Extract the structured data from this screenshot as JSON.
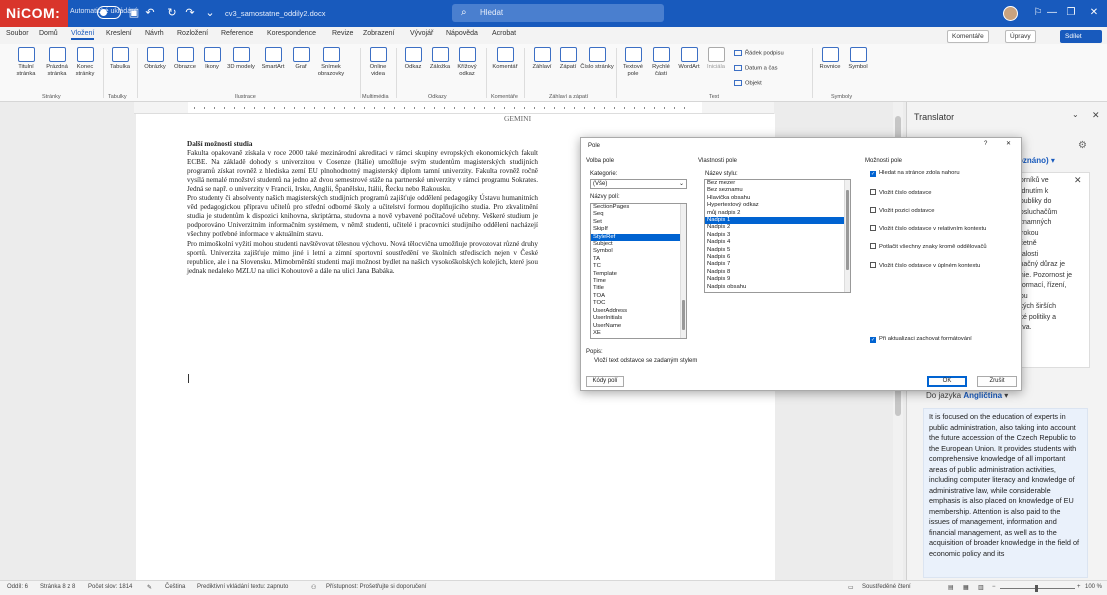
{
  "titlebar": {
    "logo": "NiCOM:",
    "autosave": "Automatické ukládání",
    "docname": "cv3_samostatne_oddily2.docx",
    "search_placeholder": "Hledat",
    "icons": [
      "save-icon",
      "undo-icon",
      "redo-icon",
      "refresh-icon",
      "more-icon"
    ]
  },
  "menubar": {
    "tabs": [
      "Soubor",
      "Domů",
      "Vložení",
      "Kreslení",
      "Návrh",
      "Rozložení",
      "Reference",
      "Korespondence",
      "Revize",
      "Zobrazení",
      "Vývojář",
      "Nápověda",
      "Acrobat"
    ],
    "active": "Vložení",
    "comments": "Komentáře",
    "editing": "Úpravy",
    "share": "Sdílet"
  },
  "ribbon": {
    "items": [
      "Titulní stránka",
      "Prázdná stránka",
      "Konec stránky",
      "Tabulka",
      "Obrázky",
      "Obrazce",
      "Ikony",
      "3D modely",
      "SmartArt",
      "Graf",
      "Snímek obrazovky",
      "Online videa",
      "Odkaz",
      "Záložka",
      "Křížový odkaz",
      "Komentář",
      "Záhlaví",
      "Zápatí",
      "Číslo stránky",
      "Textové pole",
      "Rychlé části",
      "WordArt",
      "Iniciála",
      "Rovnice",
      "Symbol"
    ],
    "small": [
      "Řádek podpisu",
      "Datum a čas",
      "Objekt"
    ],
    "groups": [
      "Stránky",
      "Tabulky",
      "Ilustrace",
      "Multimédia",
      "Odkazy",
      "Komentáře",
      "Záhlaví a zápatí",
      "Text",
      "Symboly"
    ]
  },
  "document": {
    "header": "GEMINI",
    "heading": "Další možnosti studia",
    "paragraphs": [
      "Fakulta opakovaně získala v roce 2000 také mezinárodní akreditaci v rámci skupiny evropských ekonomických fakult ECBE. Na základě dohody s univerzitou v Cosenze (Itálie) umožňuje svým studentům magisterských studijních programů získat rovněž z hlediska zemí EU plnohodnotný magisterský diplom tamní univerzity. Fakulta rovněž ročně vysílá nemalé množství studentů na jedno až dvou semestrové stáže na partnerské univerzity v rámci programu Sokrates. Jedná se např. o univerzity v Francii, Irsku, Anglii, Španělsku, Itálii, Řecku nebo Rakousku.",
      "Pro studenty či absolventy našich magisterských studijních programů zajišťuje oddělení pedagogiky Ústavu humanitních věd pedagogickou přípravu učitelů pro střední odborné školy a učitelství formou doplňujícího studia. Pro zkvalitnění studia je studentům k dispozici knihovna, skriptárna, studovna a nově vybavené počítačové učebny. Veškeré studium je podporováno Univerzitním informačním systémem, v němž studenti, učitelé i pracovníci studijního oddělení nacházejí všechny potřebné informace v aktuálním stavu.",
      "Pro mimoškolní vyžití mohou studenti navštěvovat tělesnou výchovu. Nová tělocvična umožňuje provozovat různé druhy sportů. Univerzita zajišťuje mimo jiné i letní a zimní sportovní soustředění ve školních střediscích nejen v České republice, ale i na Slovensku. Mimobrněnští studenti mají možnost bydlet na našich vysokoškolských kolejích, které jsou jednak nedaleko MZLU na ulici Kohoutově a dále na ulici Jana Babáka."
    ]
  },
  "dialog": {
    "title": "Pole",
    "help": "?",
    "close": "✕",
    "field_choice": "Volba pole",
    "categories_label": "Kategorie:",
    "category": "(Vše)",
    "field_names_label": "Názvy polí:",
    "field_names": [
      "SectionPages",
      "Seq",
      "Set",
      "SkipIf",
      "StyleRef",
      "Subject",
      "Symbol",
      "TA",
      "TC",
      "Template",
      "Time",
      "Title",
      "TOA",
      "TOC",
      "UserAddress",
      "UserInitials",
      "UserName",
      "XE"
    ],
    "selected_field": "StyleRef",
    "field_props": "Vlastnosti pole",
    "style_name_label": "Název stylu:",
    "styles": [
      "Bez mezer",
      "Bez seznamu",
      "Hlavička obsahu",
      "Hypertextový odkaz",
      "můj nadpis 2",
      "Nadpis 1",
      "Nadpis 2",
      "Nadpis 3",
      "Nadpis 4",
      "Nadpis 5",
      "Nadpis 6",
      "Nadpis 7",
      "Nadpis 8",
      "Nadpis 9",
      "Nadpis obsahu"
    ],
    "selected_style": "Nadpis 1",
    "field_options": "Možnosti pole",
    "options": [
      {
        "label": "Hledat na stránce zdola nahoru",
        "checked": true
      },
      {
        "label": "Vložit číslo odstavce",
        "checked": false
      },
      {
        "label": "Vložit pozici odstavce",
        "checked": false
      },
      {
        "label": "Vložit číslo odstavce v relativním kontextu",
        "checked": false
      },
      {
        "label": "Potlačit všechny znaky kromě oddělovačů",
        "checked": false
      },
      {
        "label": "Vložit číslo odstavce v úplném kontextu",
        "checked": false
      }
    ],
    "preserve": {
      "label": "Při aktualizaci zachovat formátování",
      "checked": true
    },
    "desc_label": "Popis:",
    "desc": "Vloží text odstavce se zadaným stylem",
    "codes_btn": "Kódy polí",
    "ok": "OK",
    "cancel": "Zrušit"
  },
  "translator": {
    "title": "Translator",
    "source_lang": "oznáno)",
    "source_text": "borníků ve\nlédnutím k\nepubliky do\nposluchačům\nýznamných\nširokou\nvčetně\nmalosti\nznačný důraz je\nunie. Pozornost je\nnformací, řízení,\nobu\nských širších\nské politiky a\nráva.",
    "dest_label": "Do jazyka",
    "dest_lang": "Angličtina",
    "output": "It is focused on the education of experts in public administration, also taking into account the future accession of the Czech Republic to the European Union. It provides students with comprehensive knowledge of all important areas of public administration activities, including computer literacy and knowledge of administrative law, while considerable emphasis is also placed on knowledge of EU membership. Attention is also paid to the issues of management, information and financial management, as well as to the acquisition of broader knowledge in the field of economic policy and its"
  },
  "status": {
    "section": "Oddíl: 6",
    "page": "Stránka 8 z 8",
    "words": "Počet slov: 1814",
    "language": "Čeština",
    "predict": "Prediktivní vkládání textu: zapnuto",
    "access": "Přístupnost: Prošetřujte si doporučení",
    "focus": "Soustředěné čtení",
    "zoom": "100 %"
  }
}
